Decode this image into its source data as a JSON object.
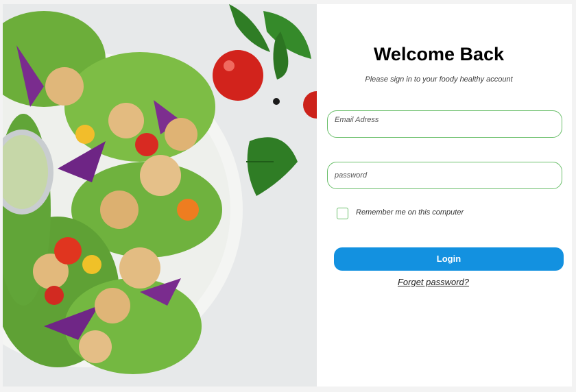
{
  "hero": {
    "image_description_icon": "salad-plate-image"
  },
  "login": {
    "title": "Welcome Back",
    "subtitle": "Please sign in to your foody healthy account",
    "email_placeholder": "Email Adress",
    "password_placeholder": "password",
    "remember_label": "Remember me on this computer",
    "login_label": "Login",
    "forgot_label": "Forget password?"
  },
  "colors": {
    "accent": "#1391e0",
    "field_border": "#6bbf6b",
    "background": "#f3f3f3"
  }
}
